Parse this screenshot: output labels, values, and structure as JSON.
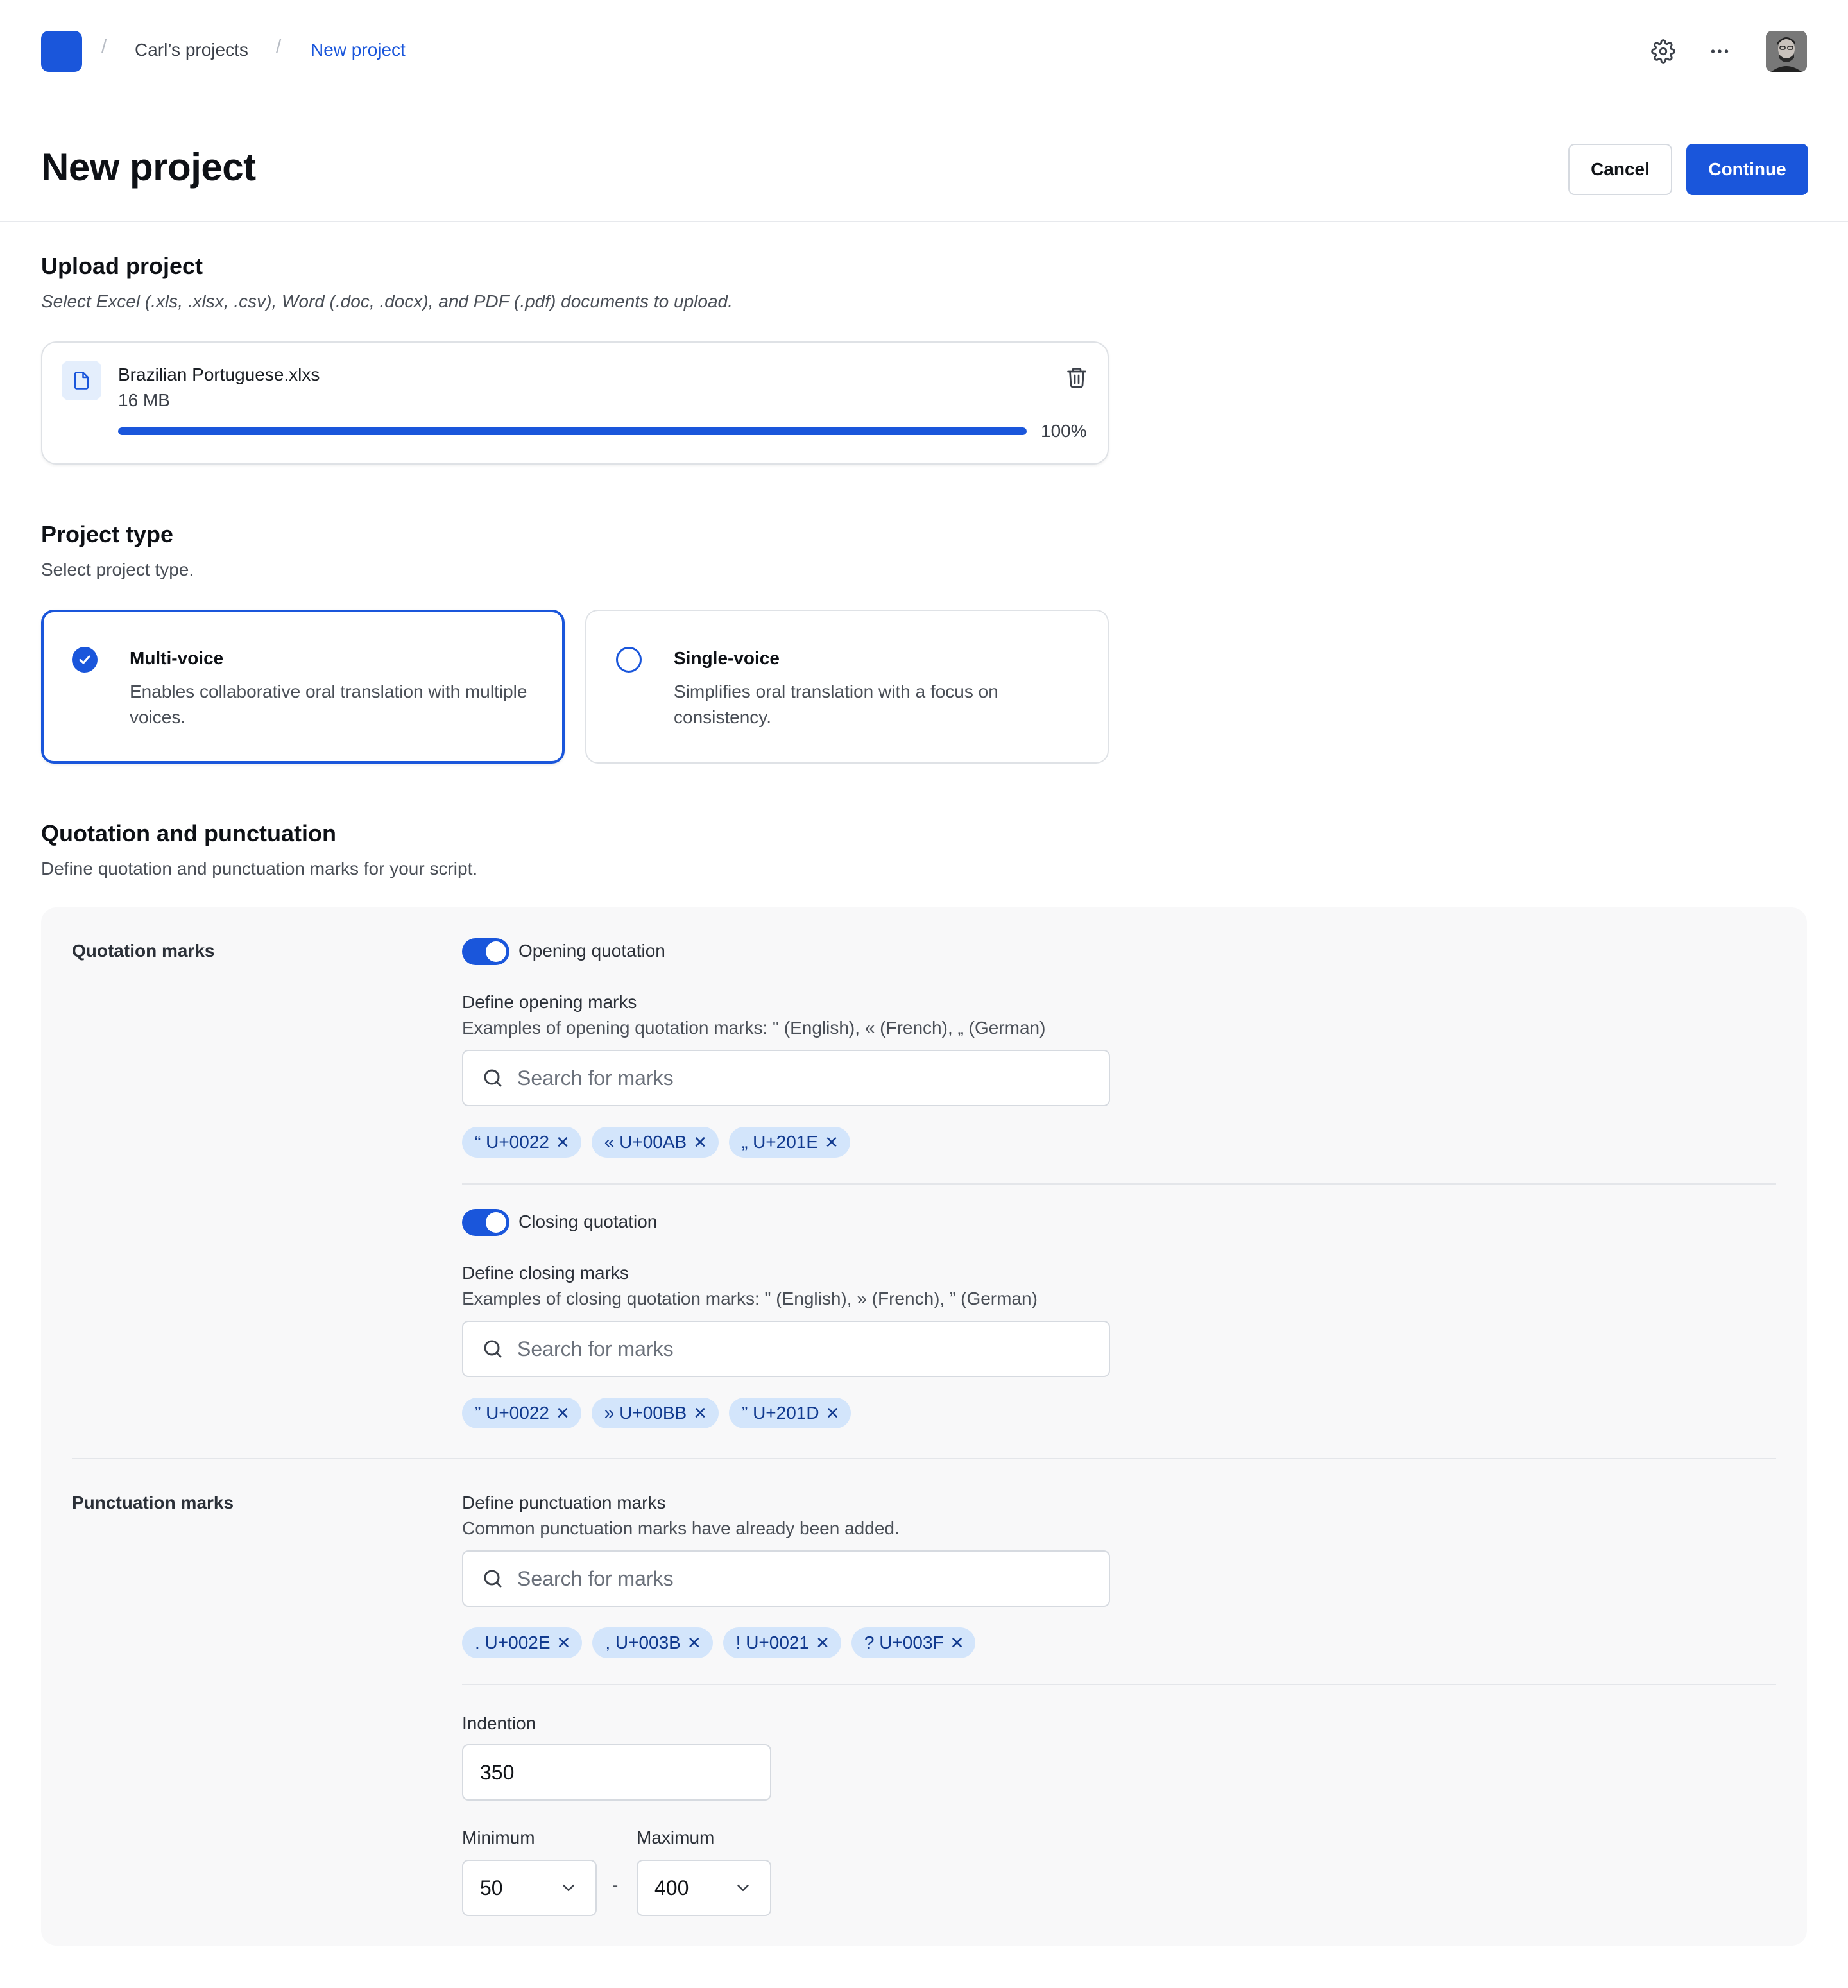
{
  "breadcrumb": {
    "separator": "/",
    "items": [
      "Carl’s projects",
      "New project"
    ]
  },
  "page": {
    "title": "New project",
    "cancel_label": "Cancel",
    "continue_label": "Continue"
  },
  "upload": {
    "title": "Upload project",
    "description": "Select Excel (.xls, .xlsx, .csv), Word (.doc, .docx), and PDF (.pdf) documents to upload.",
    "file": {
      "name": "Brazilian Portuguese.xlxs",
      "size": "16 MB",
      "progress": 1.0,
      "progress_text": "100%"
    }
  },
  "project_type": {
    "title": "Project type",
    "description": "Select project type.",
    "options": [
      {
        "title": "Multi-voice",
        "description": "Enables collaborative oral translation with multiple voices.",
        "selected": true
      },
      {
        "title": "Single-voice",
        "description": "Simplifies oral translation with a focus on consistency.",
        "selected": false
      }
    ]
  },
  "quotation": {
    "title": "Quotation and punctuation",
    "description": "Define quotation and punctuation marks for your script.",
    "quotation_marks_label": "Quotation marks",
    "opening": {
      "toggle_label": "Opening quotation",
      "enabled": true,
      "field_title": "Define opening marks",
      "field_desc": "Examples of opening quotation marks: \" (English), « (French), „ (German)",
      "placeholder": "Search for marks",
      "chips": [
        "“ U+0022",
        "« U+00AB",
        "„ U+201E"
      ]
    },
    "closing": {
      "toggle_label": "Closing quotation",
      "enabled": true,
      "field_title": "Define closing marks",
      "field_desc": "Examples of closing quotation marks: \" (English), » (French), ” (German)",
      "placeholder": "Search for marks",
      "chips": [
        "” U+0022",
        "» U+00BB",
        "” U+201D"
      ]
    },
    "punctuation_label": "Punctuation marks",
    "punctuation": {
      "field_title": "Define punctuation marks",
      "field_desc": "Common punctuation marks have already been added.",
      "placeholder": "Search for marks",
      "chips": [
        ". U+002E",
        ", U+003B",
        "! U+0021",
        "? U+003F"
      ]
    },
    "indention": {
      "label": "Indention",
      "value": "350",
      "minimum_label": "Minimum",
      "minimum_value": "50",
      "maximum_label": "Maximum",
      "maximum_value": "400",
      "range_separator": "-"
    }
  },
  "icons": {
    "settings": "gear-icon",
    "more": "more-horizontal-icon",
    "file": "file-icon",
    "delete": "trash-icon",
    "search": "search-icon",
    "check": "check-icon",
    "chevron": "chevron-down-icon",
    "remove": "close-icon"
  },
  "colors": {
    "accent": "#1a56db",
    "chip_bg": "#d3e5fb",
    "chip_text": "#113a8f",
    "panel_bg": "#f8f8f9"
  }
}
